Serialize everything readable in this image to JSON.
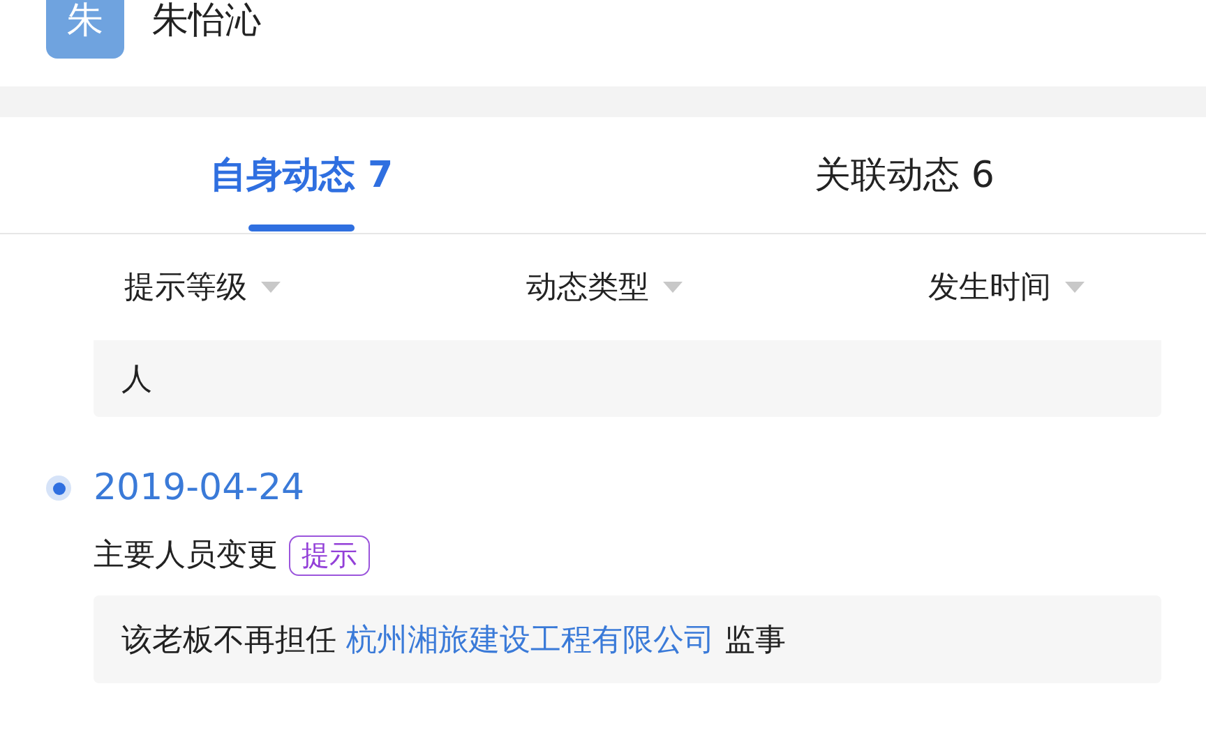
{
  "header": {
    "avatar_letter": "朱",
    "name": "朱怡沁"
  },
  "tabs": [
    {
      "label": "自身动态 7",
      "selected": true
    },
    {
      "label": "关联动态 6",
      "selected": false
    }
  ],
  "filters": [
    "提示等级",
    "动态类型",
    "发生时间"
  ],
  "previous_entry": {
    "detail": "人"
  },
  "entries": [
    {
      "date": "2019-04-24",
      "type": "主要人员变更",
      "tag": "提示",
      "detail_prefix": "该老板不再担任",
      "company": "杭州湘旅建设工程有限公司",
      "detail_suffix": "监事"
    }
  ]
}
